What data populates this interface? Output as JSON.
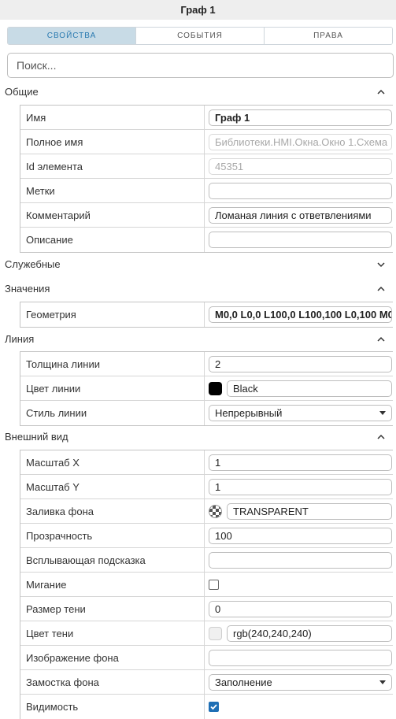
{
  "window": {
    "title": "Граф 1"
  },
  "tabs": [
    {
      "label": "свойства",
      "active": true
    },
    {
      "label": "события",
      "active": false
    },
    {
      "label": "права",
      "active": false
    }
  ],
  "search": {
    "placeholder": "Поиск...",
    "value": ""
  },
  "sections": {
    "general": {
      "title": "Общие",
      "expanded": true,
      "rows": {
        "name": {
          "label": "Имя",
          "value": "Граф 1"
        },
        "full_name": {
          "label": "Полное имя",
          "value": "Библиотеки.HMI.Окна.Окно 1.Схема"
        },
        "element_id": {
          "label": "Id элемента",
          "value": "45351"
        },
        "tags": {
          "label": "Метки",
          "value": ""
        },
        "comment": {
          "label": "Комментарий",
          "value": "Ломаная линия с ответвлениями"
        },
        "description": {
          "label": "Описание",
          "value": ""
        }
      }
    },
    "service": {
      "title": "Служебные",
      "expanded": false
    },
    "values": {
      "title": "Значения",
      "expanded": true,
      "rows": {
        "geometry": {
          "label": "Геометрия",
          "value": "M0,0 L0,0 L100,0 L100,100 L0,100 M0"
        }
      }
    },
    "line": {
      "title": "Линия",
      "expanded": true,
      "rows": {
        "width": {
          "label": "Толщина линии",
          "value": "2"
        },
        "color": {
          "label": "Цвет линии",
          "value": "Black",
          "swatch": "#000000"
        },
        "style": {
          "label": "Стиль линии",
          "value": "Непрерывный"
        }
      }
    },
    "appearance": {
      "title": "Внешний вид",
      "expanded": true,
      "rows": {
        "scale_x": {
          "label": "Масштаб X",
          "value": "1"
        },
        "scale_y": {
          "label": "Масштаб Y",
          "value": "1"
        },
        "fill": {
          "label": "Заливка фона",
          "value": "TRANSPARENT"
        },
        "opacity": {
          "label": "Прозрачность",
          "value": "100"
        },
        "tooltip": {
          "label": "Всплывающая подсказка",
          "value": ""
        },
        "blink": {
          "label": "Мигание",
          "checked": false
        },
        "shadow_size": {
          "label": "Размер тени",
          "value": "0"
        },
        "shadow_color": {
          "label": "Цвет тени",
          "value": "rgb(240,240,240)",
          "swatch": "#f0f0f0"
        },
        "bg_image": {
          "label": "Изображение фона",
          "value": ""
        },
        "bg_tiling": {
          "label": "Замостка фона",
          "value": "Заполнение"
        },
        "visibility": {
          "label": "Видимость",
          "checked": true
        }
      }
    }
  },
  "colors": {
    "accent": "#2a7ab0",
    "active_tab_bg": "#c8dbe6",
    "checkbox_checked": "#1f6fb5"
  }
}
